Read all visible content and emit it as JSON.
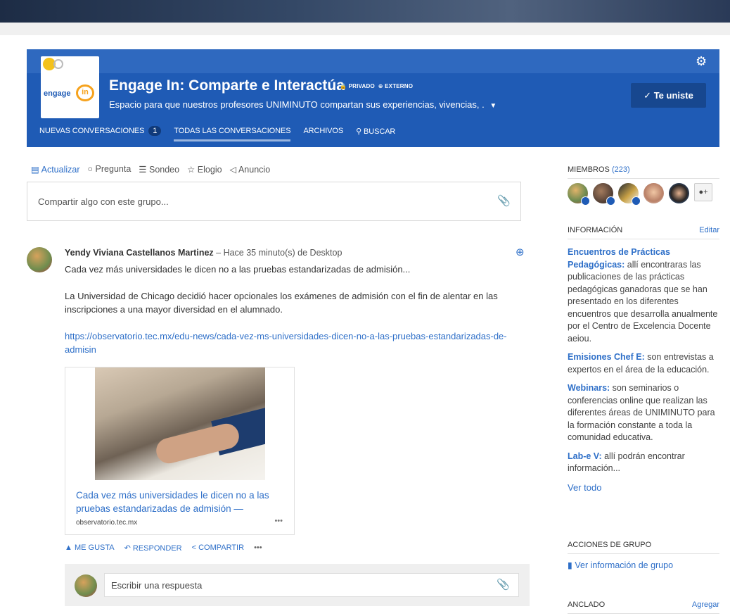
{
  "group": {
    "title": "Engage In: Comparte e Interactúa",
    "privacy_tag": "PRIVADO",
    "external_tag": "EXTERNO",
    "description": "Espacio para que nuestros profesores UNIMINUTO compartan sus experiencias, vivencias, .",
    "join_label": "Te uniste",
    "logo_text": "engage",
    "logo_in": "in"
  },
  "nav": {
    "new_conversations": "NUEVAS CONVERSACIONES",
    "new_count": "1",
    "all_conversations": "TODAS LAS CONVERSACIONES",
    "files": "ARCHIVOS",
    "search": "BUSCAR"
  },
  "compose": {
    "tabs": [
      {
        "icon": "update-icon",
        "label": "Actualizar"
      },
      {
        "icon": "question-icon",
        "label": "Pregunta"
      },
      {
        "icon": "poll-icon",
        "label": "Sondeo"
      },
      {
        "icon": "trophy-icon",
        "label": "Elogio"
      },
      {
        "icon": "megaphone-icon",
        "label": "Anuncio"
      }
    ],
    "placeholder": "Compartir algo con este grupo..."
  },
  "post": {
    "author": "Yendy Viviana Castellanos Martinez",
    "meta": " – Hace 35 minuto(s) de Desktop",
    "line1": " Cada vez más universidades le dicen no a las pruebas estandarizadas de admisión...",
    "line2": "La Universidad de Chicago decidió hacer opcionales los exámenes de admisión con el fin de alentar en las inscripciones a una mayor diversidad en el alumnado.",
    "link": " https://observatorio.tec.mx/edu-news/cada-vez-ms-universidades-dicen-no-a-las-pruebas-estandarizadas-de-admisin",
    "card_title": "Cada vez más universidades le dicen no a las pruebas estandarizadas de admisión —",
    "card_source": "observatorio.tec.mx",
    "actions": {
      "like": "ME GUSTA",
      "reply": "RESPONDER",
      "share": "COMPARTIR"
    },
    "reply_placeholder": "Escribir una respuesta"
  },
  "sidebar": {
    "members_label": "MIEMBROS",
    "members_count": "(223)",
    "info_label": "INFORMACIÓN",
    "edit_label": "Editar",
    "info": [
      {
        "key": "Encuentros de Prácticas Pedagógicas:",
        "text": " allí encontraras las publicaciones de las prácticas pedagógicas ganadoras que se han presentado en los diferentes encuentros que desarrolla anualmente  por el Centro de Excelencia Docente aeiou."
      },
      {
        "key": "Emisiones Chef E:",
        "text": " son entrevistas a expertos en el área de la educación."
      },
      {
        "key": "Webinars:",
        "text": " son seminarios o conferencias online que realizan las diferentes áreas de UNIMINUTO para la formación constante a toda la comunidad educativa."
      },
      {
        "key": "Lab-e V:",
        "text": " allí podrán encontrar información..."
      }
    ],
    "see_all": "Ver todo",
    "group_actions_label": "ACCIONES DE GRUPO",
    "group_info_link": "Ver información de grupo",
    "pinned_label": "ANCLADO",
    "add_label": "Agregar"
  }
}
